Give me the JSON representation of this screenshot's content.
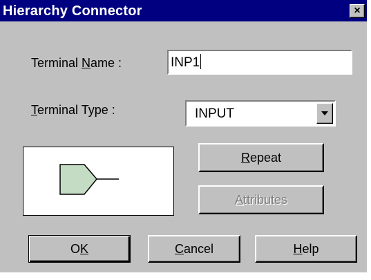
{
  "window": {
    "title": "Hierarchy Connector",
    "close_glyph": "×"
  },
  "terminal_name": {
    "label_pre": "Terminal ",
    "label_accel": "N",
    "label_post": "ame :",
    "value": "INP1"
  },
  "terminal_type": {
    "label_accel": "T",
    "label_post": "erminal Type :",
    "selected": "INPUT"
  },
  "preview": {
    "symbol": "input-terminal",
    "fill_color": "#c4dcc4"
  },
  "buttons": {
    "repeat": {
      "accel": "R",
      "rest": "epeat"
    },
    "attributes": {
      "accel": "A",
      "rest": "ttributes",
      "enabled": false
    },
    "ok": {
      "pre": "O",
      "accel": "K",
      "rest": ""
    },
    "cancel": {
      "accel": "C",
      "rest": "ancel"
    },
    "help": {
      "accel": "H",
      "rest": "elp"
    }
  }
}
